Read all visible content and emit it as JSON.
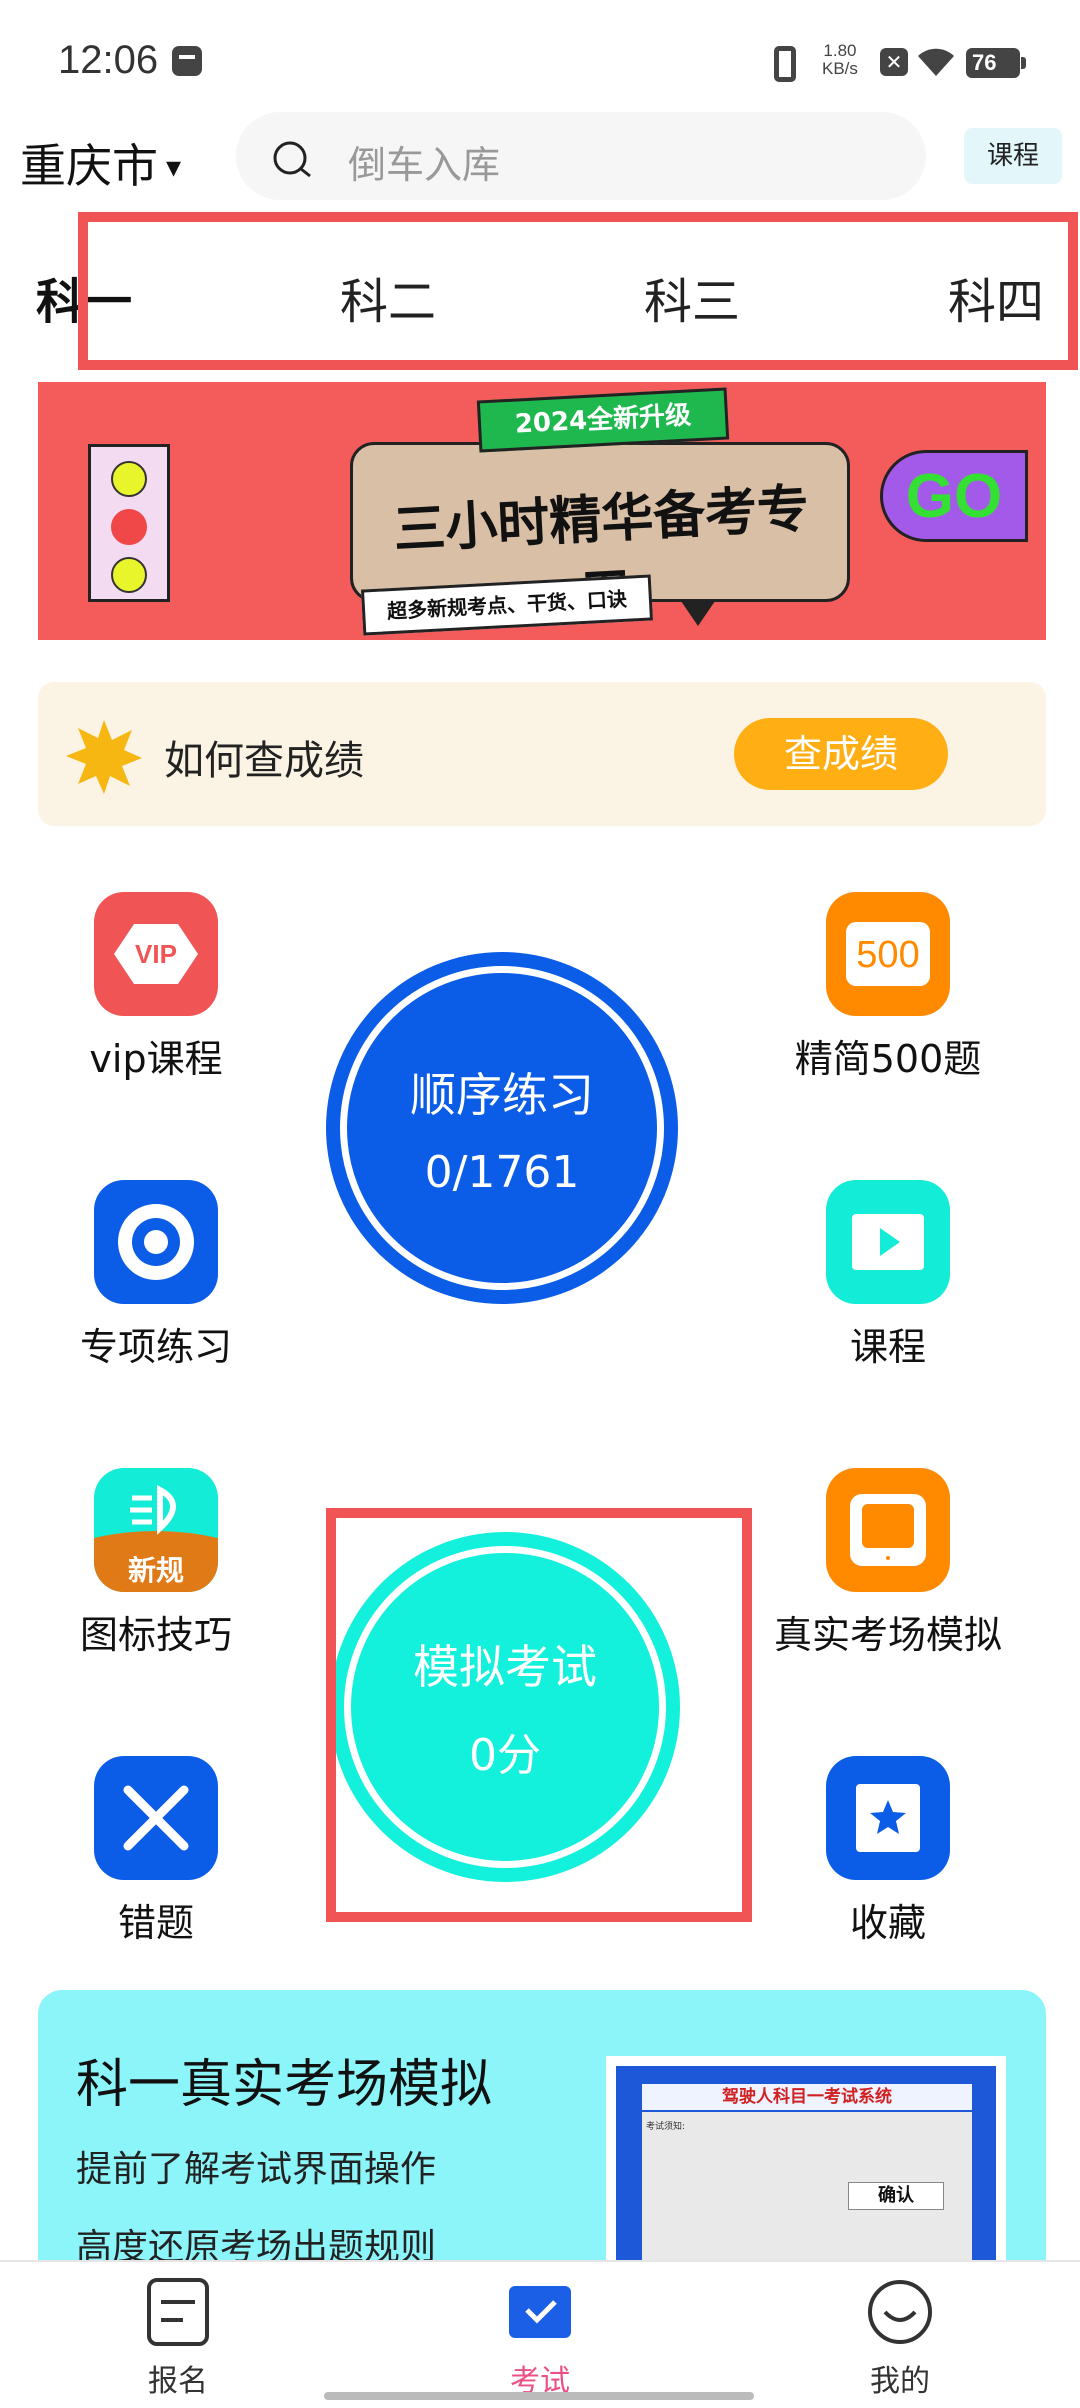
{
  "status_bar": {
    "time": "12:06",
    "net_speed_value": "1.80",
    "net_speed_unit": "KB/s",
    "battery": "76"
  },
  "header": {
    "city": "重庆市",
    "city_arrow": "▾",
    "search_placeholder": "倒车入库",
    "course_button": "课程"
  },
  "subject_tabs": [
    {
      "label": "科一",
      "active": true
    },
    {
      "label": "科二",
      "active": false
    },
    {
      "label": "科三",
      "active": false
    },
    {
      "label": "科四",
      "active": false
    }
  ],
  "banner": {
    "tag": "2024全新升级",
    "title": "三小时精华备考专用",
    "subtitle": "超多新规考点、干货、口诀",
    "go": "GO"
  },
  "score_card": {
    "text": "如何查成绩",
    "button": "查成绩"
  },
  "grid": {
    "vip": {
      "label": "vip课程",
      "icon_text": "VIP"
    },
    "jianjing": {
      "label": "精简500题",
      "icon_text": "500"
    },
    "zhuanxiang": {
      "label": "专项练习"
    },
    "kecheng": {
      "label": "课程"
    },
    "tubiao": {
      "label": "图标技巧",
      "icon_text": "新规"
    },
    "zhenshi": {
      "label": "真实考场模拟"
    },
    "cuoti": {
      "label": "错题"
    },
    "shoucang": {
      "label": "收藏"
    }
  },
  "practice": {
    "title": "顺序练习",
    "progress": "0/1761"
  },
  "mock_exam": {
    "title": "模拟考试",
    "score": "0分"
  },
  "promo": {
    "title": "科一真实考场模拟",
    "line1": "提前了解考试界面操作",
    "line2": "高度还原考场出题规则",
    "screenshot": {
      "header": "驾驶人科目一考试系统",
      "notes_title": "考试须知:",
      "confirm": "确认"
    }
  },
  "bottom_nav": [
    {
      "label": "报名",
      "active": false
    },
    {
      "label": "考试",
      "active": true
    },
    {
      "label": "我的",
      "active": false
    }
  ],
  "colors": {
    "accent_pink": "#ec4f86",
    "practice_blue": "#0b5ce6",
    "mock_cyan": "#13f0dc",
    "orange": "#ff8a00",
    "highlight_red": "#f05454"
  }
}
